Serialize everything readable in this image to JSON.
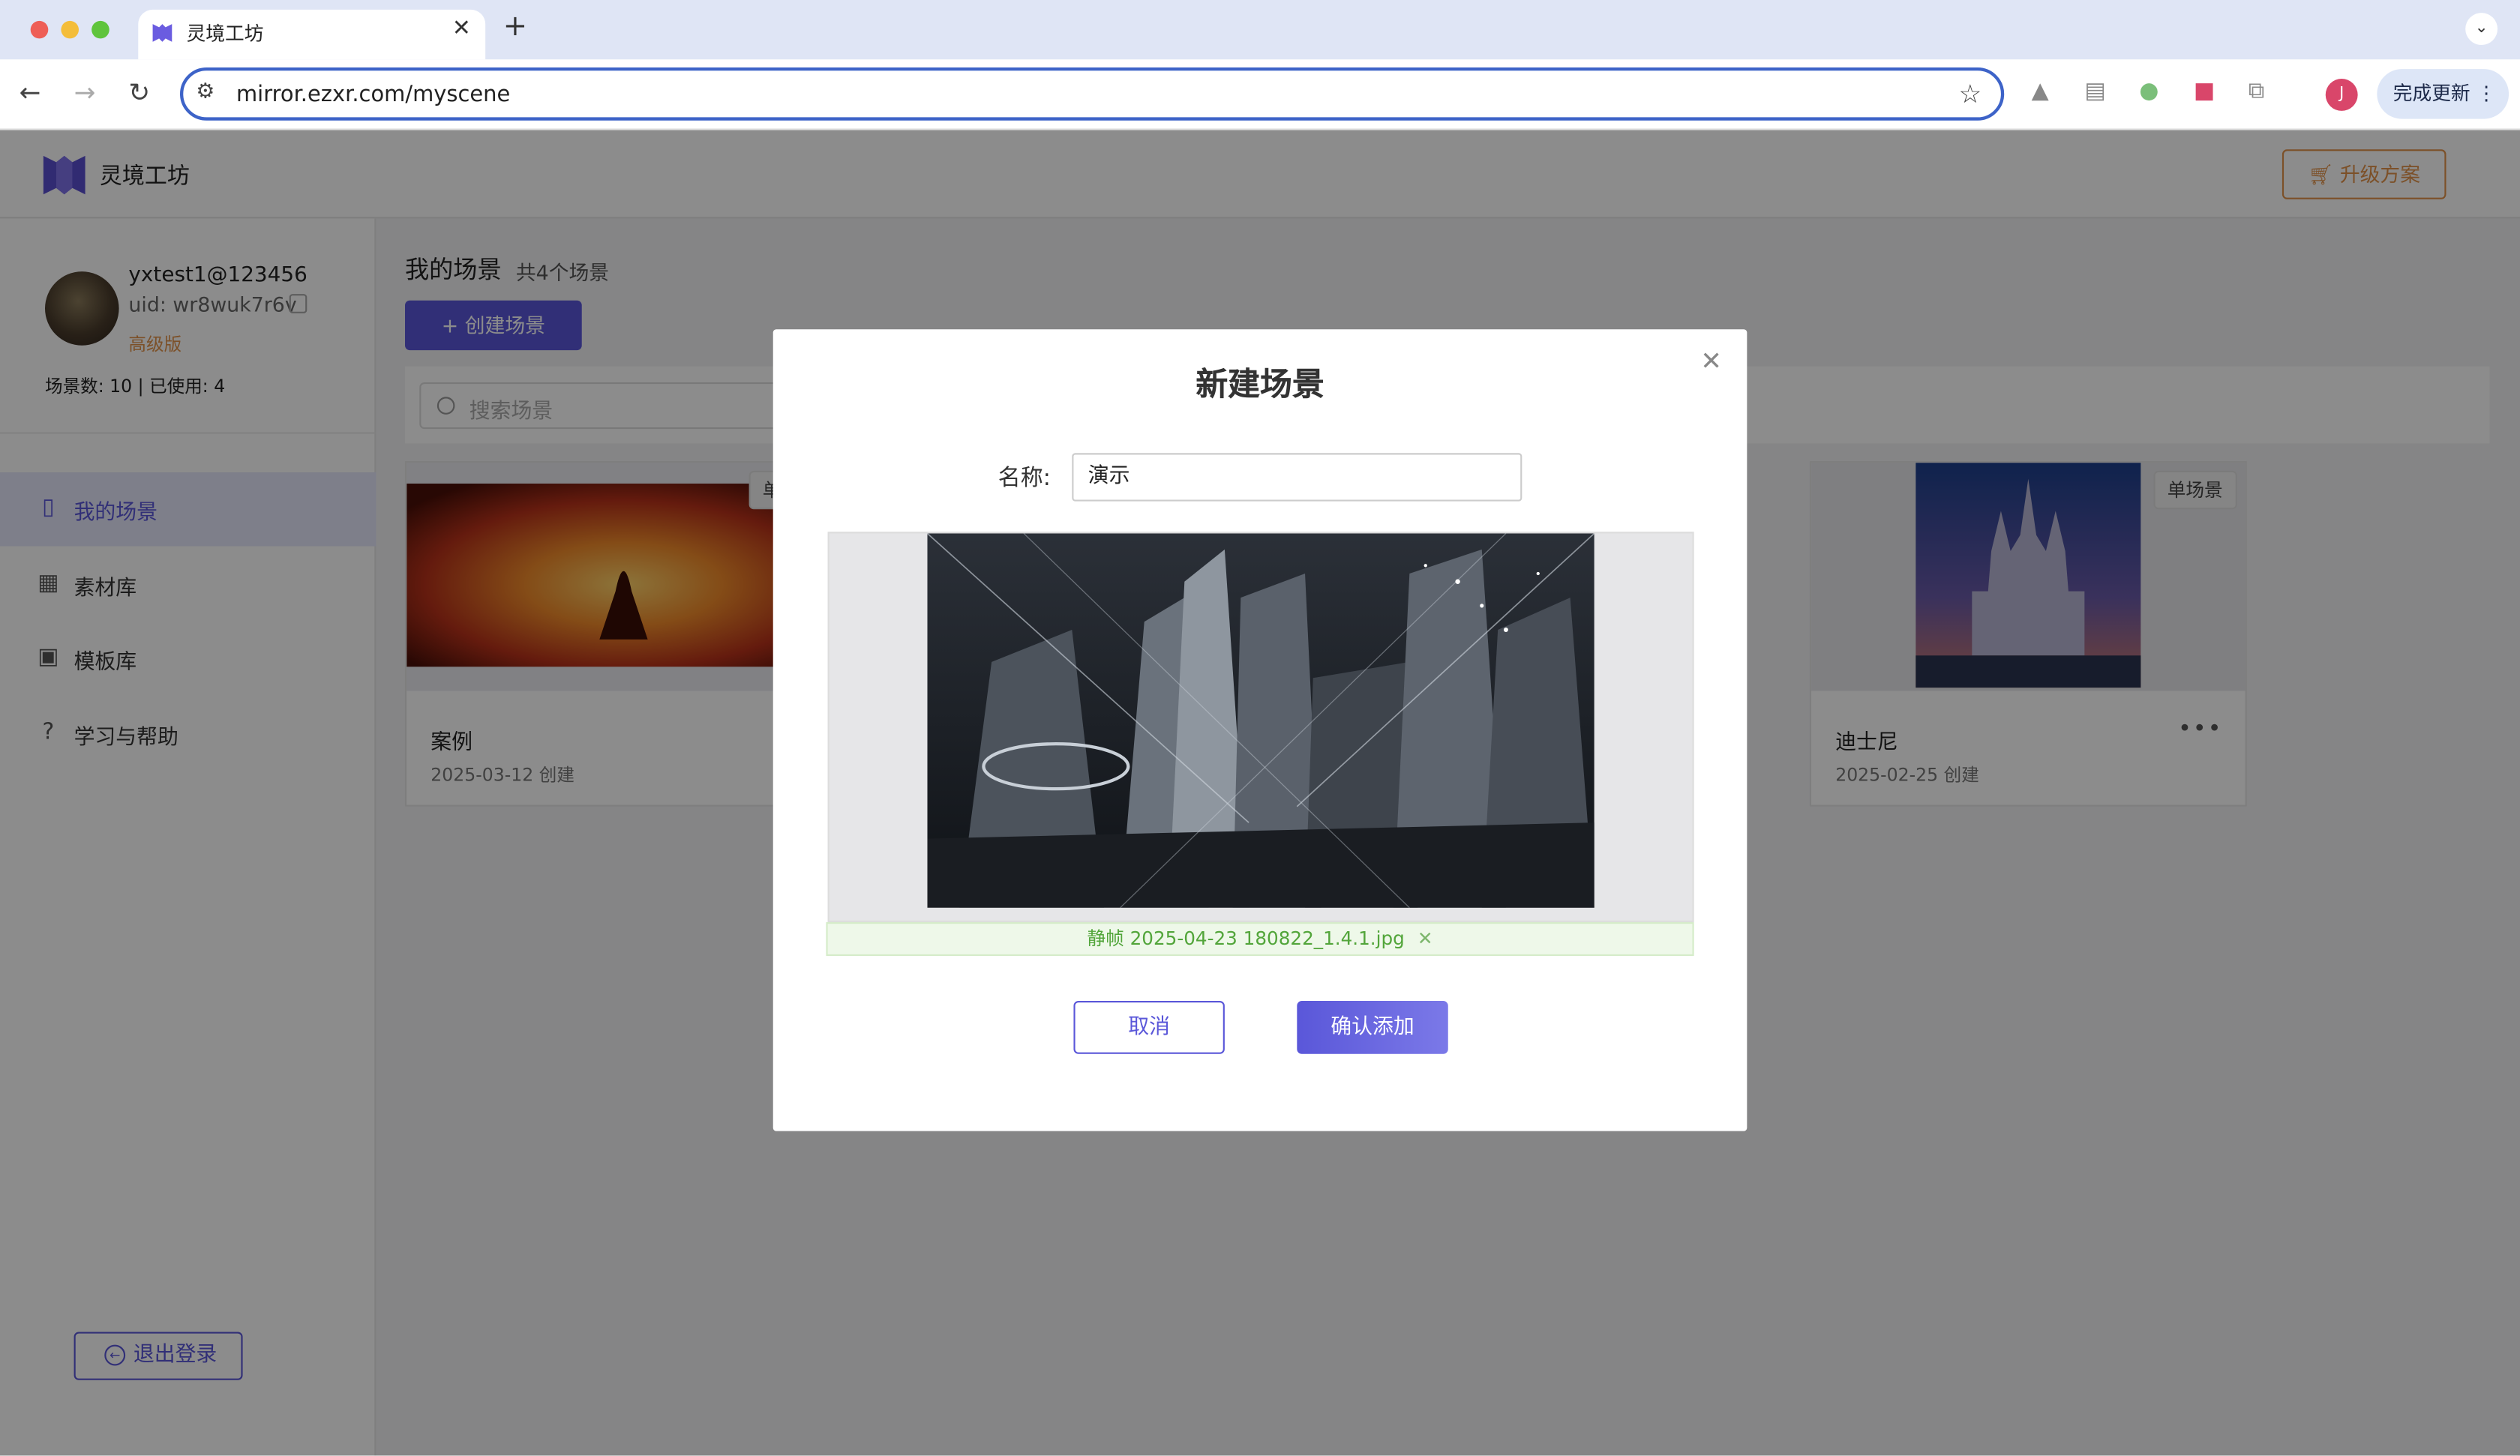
{
  "browser": {
    "tab_title": "灵境工坊",
    "url": "mirror.ezxr.com/myscene",
    "update_label": "完成更新",
    "profile_initial": "J"
  },
  "header": {
    "app_name": "灵境工坊",
    "upgrade_label": "升级方案"
  },
  "user": {
    "name": "yxtest1@123456",
    "uid": "uid: wr8wuk7r6v",
    "level": "高级版",
    "quota": "场景数: 10 | 已使用: 4"
  },
  "sidebar": {
    "items": [
      {
        "label": "我的场景",
        "icon": "bookmark-icon",
        "active": true
      },
      {
        "label": "素材库",
        "icon": "grid-icon",
        "active": false
      },
      {
        "label": "模板库",
        "icon": "gift-icon",
        "active": false
      },
      {
        "label": "学习与帮助",
        "icon": "help-icon",
        "active": false
      }
    ],
    "logout_label": "退出登录"
  },
  "main": {
    "title": "我的场景",
    "count": "共4个场景",
    "create_label": "+ 创建场景",
    "search_placeholder": "搜索场景",
    "cards": [
      {
        "title": "案例",
        "date": "2025-03-12 创建",
        "tag": "单场景"
      },
      {
        "title": "迪士尼",
        "date": "2025-02-25 创建",
        "tag": "单场景"
      }
    ]
  },
  "modal": {
    "title": "新建场景",
    "name_label": "名称:",
    "name_value": "演示",
    "file_name": "静帧 2025-04-23 180822_1.4.1.jpg",
    "cancel_label": "取消",
    "confirm_label": "确认添加"
  },
  "colors": {
    "accent": "#5a57d9",
    "warning": "#e2934a",
    "success": "#52a53a"
  }
}
